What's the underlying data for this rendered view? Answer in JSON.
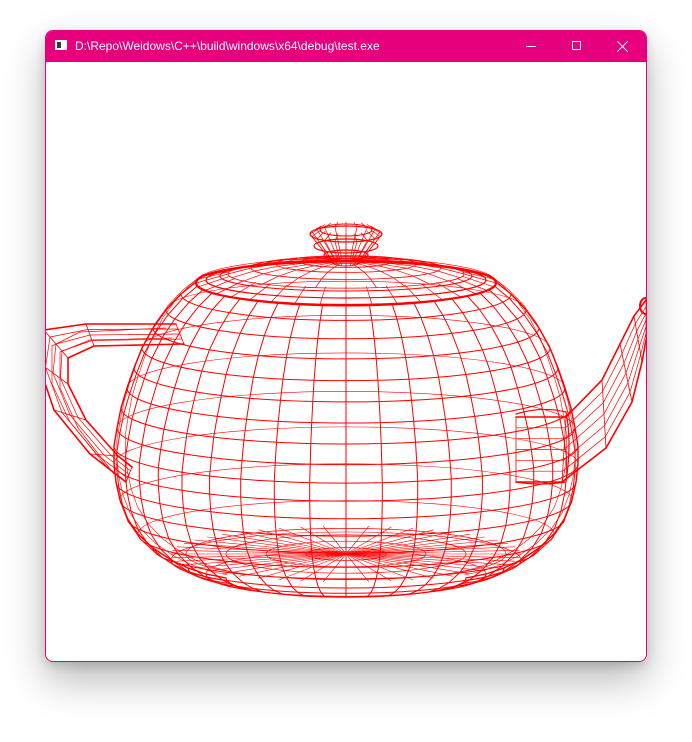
{
  "window": {
    "title": "D:\\Repo\\Weidows\\C++\\build\\windows\\x64\\debug\\test.exe",
    "accent_color": "#e6007e",
    "app_icon": "console-window-icon",
    "controls": {
      "minimize_icon": "minimize-icon",
      "maximize_icon": "maximize-icon",
      "close_icon": "close-icon"
    }
  },
  "canvas": {
    "background_color": "#ffffff",
    "render": {
      "subject": "teapot",
      "style": "wireframe",
      "line_color": "#ff0000"
    }
  }
}
